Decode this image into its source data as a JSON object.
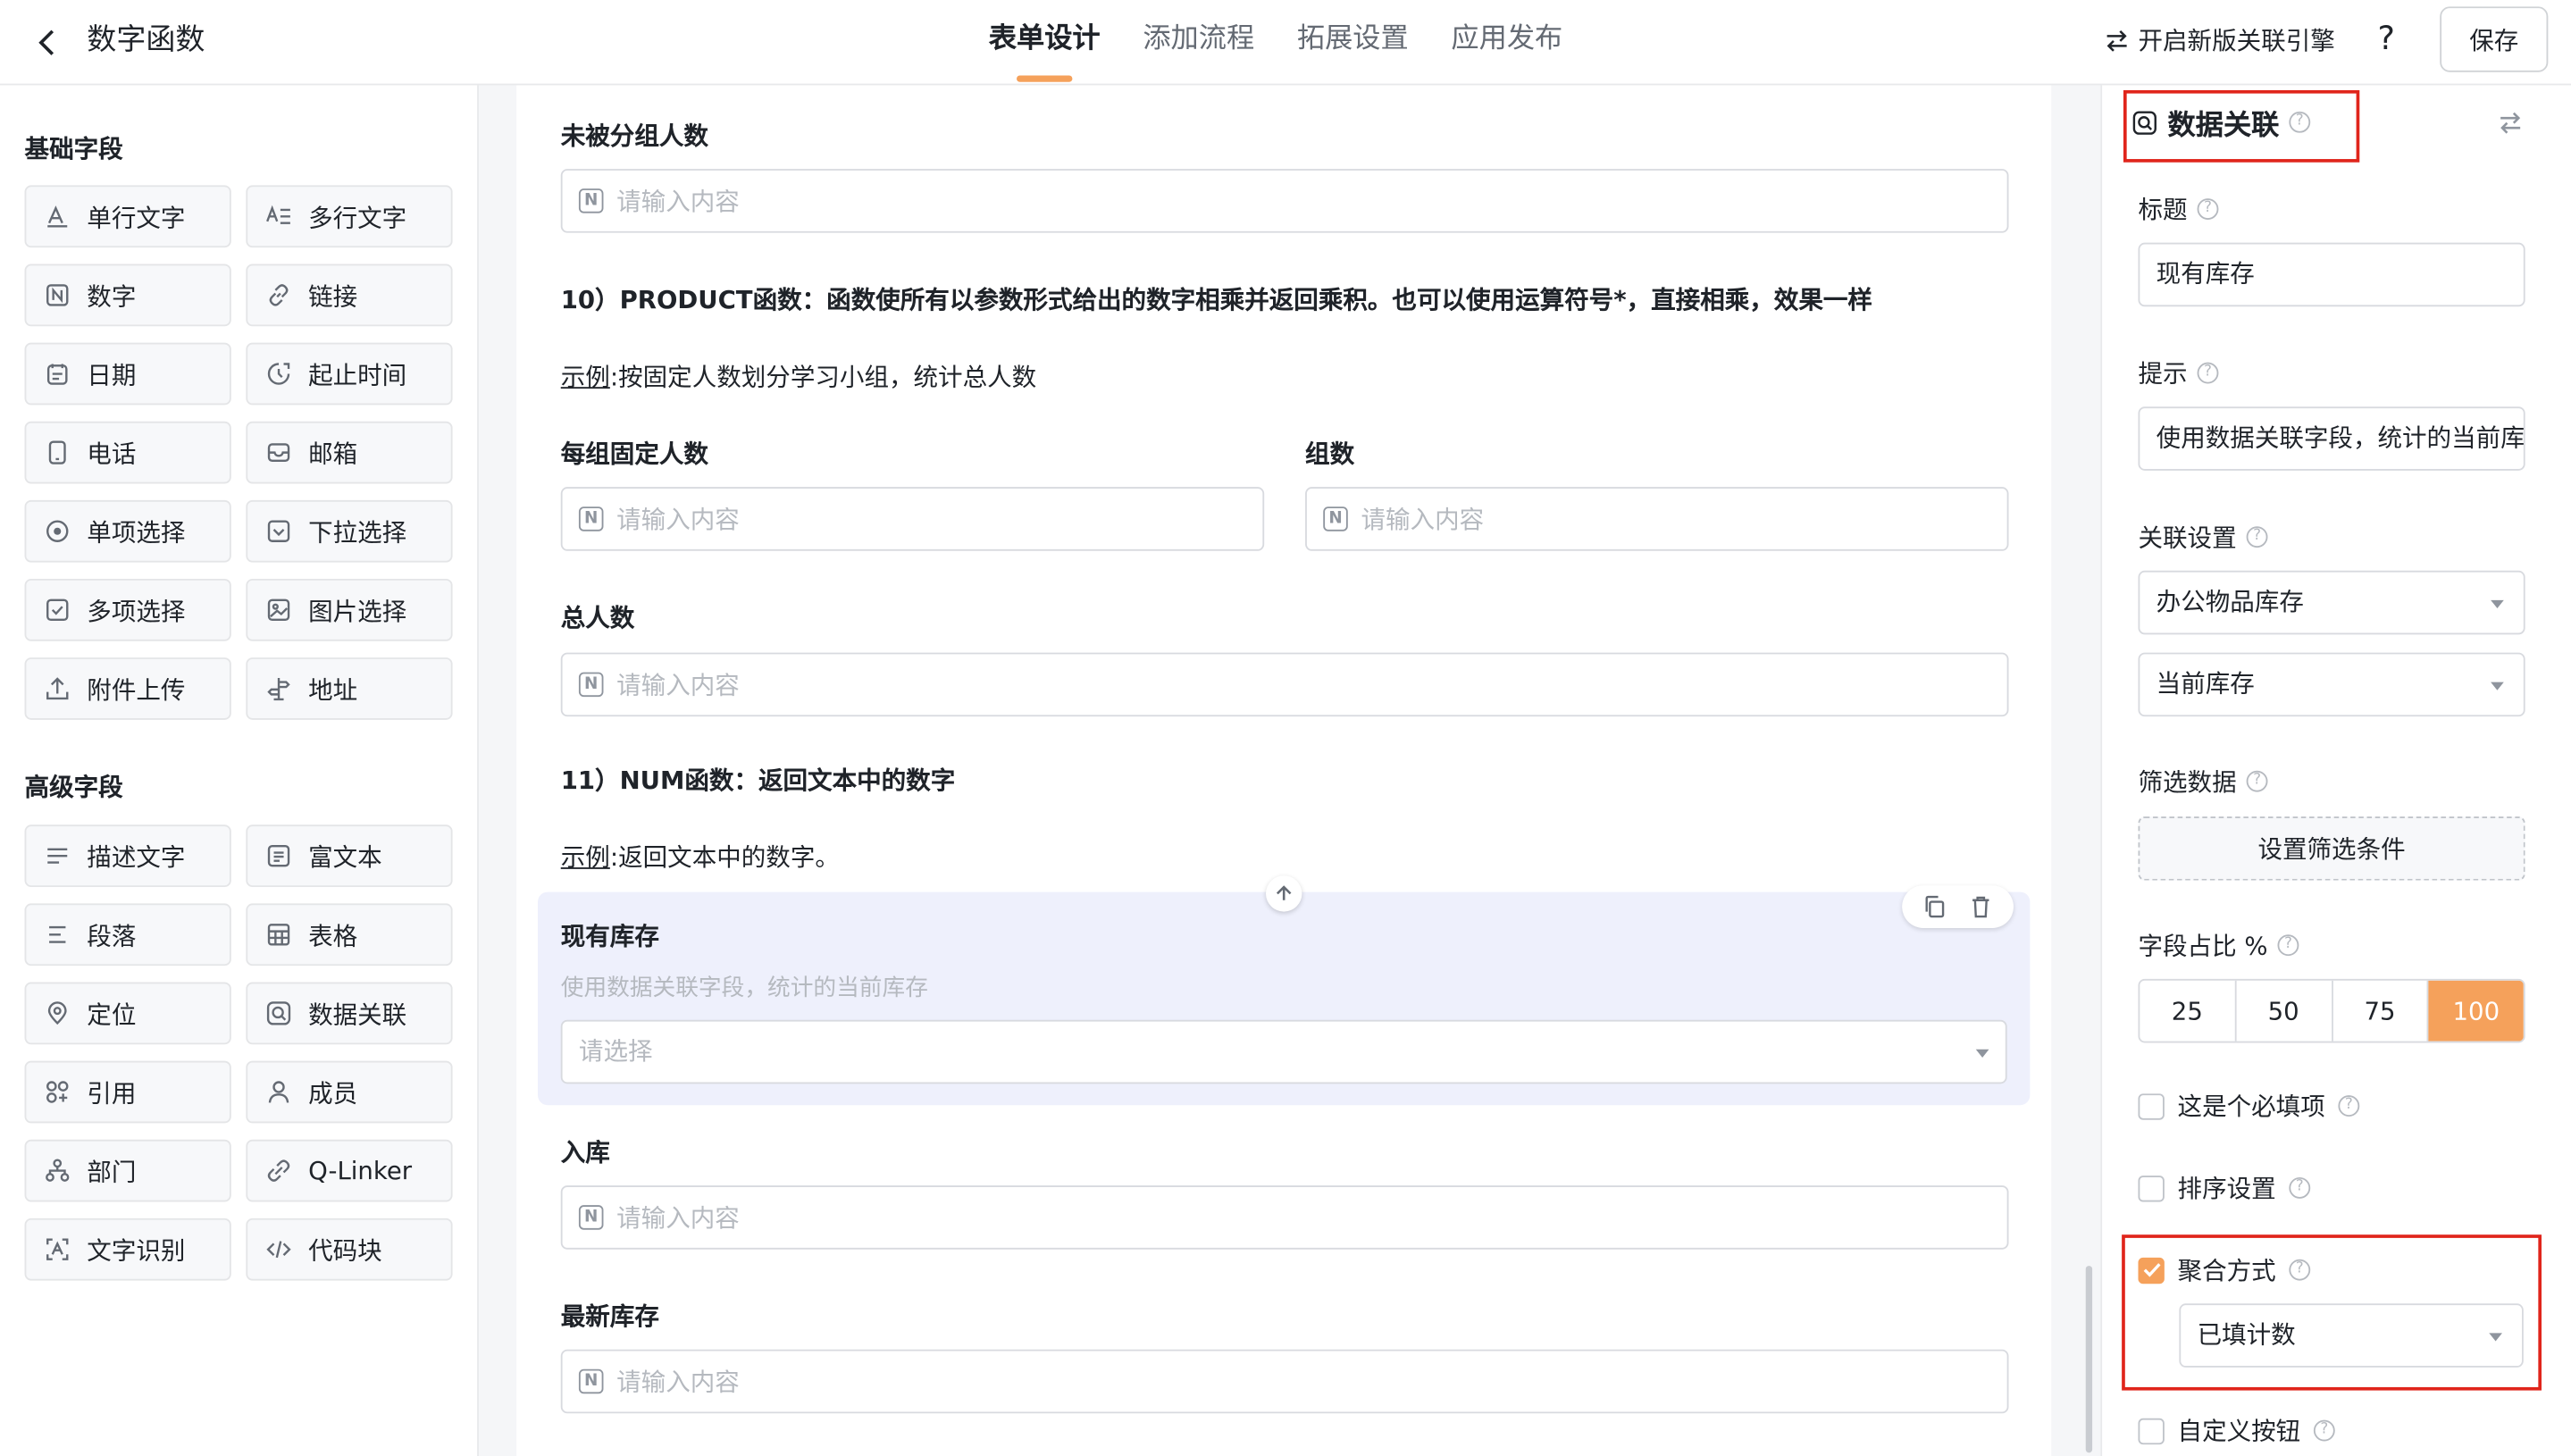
{
  "header": {
    "title": "数字函数",
    "tabs": [
      {
        "label": "表单设计",
        "active": true
      },
      {
        "label": "添加流程",
        "active": false
      },
      {
        "label": "拓展设置",
        "active": false
      },
      {
        "label": "应用发布",
        "active": false
      }
    ],
    "engine_label": "开启新版关联引擎",
    "help_label": "?",
    "save_label": "保存"
  },
  "left": {
    "basic_title": "基础字段",
    "basic_fields": [
      {
        "label": "单行文字",
        "icon": "single-line-text-icon"
      },
      {
        "label": "多行文字",
        "icon": "multi-line-text-icon"
      },
      {
        "label": "数字",
        "icon": "number-icon"
      },
      {
        "label": "链接",
        "icon": "link-icon"
      },
      {
        "label": "日期",
        "icon": "calendar-icon"
      },
      {
        "label": "起止时间",
        "icon": "time-range-icon"
      },
      {
        "label": "电话",
        "icon": "phone-icon"
      },
      {
        "label": "邮箱",
        "icon": "mail-icon"
      },
      {
        "label": "单项选择",
        "icon": "radio-icon"
      },
      {
        "label": "下拉选择",
        "icon": "dropdown-icon"
      },
      {
        "label": "多项选择",
        "icon": "checkbox-icon"
      },
      {
        "label": "图片选择",
        "icon": "image-icon"
      },
      {
        "label": "附件上传",
        "icon": "upload-icon"
      },
      {
        "label": "地址",
        "icon": "signpost-icon"
      }
    ],
    "advanced_title": "高级字段",
    "advanced_fields": [
      {
        "label": "描述文字",
        "icon": "description-icon"
      },
      {
        "label": "富文本",
        "icon": "rich-text-icon"
      },
      {
        "label": "段落",
        "icon": "paragraph-icon"
      },
      {
        "label": "表格",
        "icon": "table-icon"
      },
      {
        "label": "定位",
        "icon": "location-icon"
      },
      {
        "label": "数据关联",
        "icon": "data-link-icon"
      },
      {
        "label": "引用",
        "icon": "reference-icon"
      },
      {
        "label": "成员",
        "icon": "member-icon"
      },
      {
        "label": "部门",
        "icon": "department-icon"
      },
      {
        "label": "Q-Linker",
        "icon": "qlinker-icon"
      },
      {
        "label": "文字识别",
        "icon": "ocr-icon"
      },
      {
        "label": "代码块",
        "icon": "code-icon"
      }
    ]
  },
  "canvas": {
    "ungrouped_label": "未被分组人数",
    "placeholder": "请输入内容",
    "product_title": "10）PRODUCT函数：函数使所有以参数形式给出的数字相乘并返回乘积。也可以使用运算符号*，直接相乘，效果一样",
    "example_word": "示例",
    "product_example": ":按固定人数划分学习小组，统计总人数",
    "per_group_label": "每组固定人数",
    "groups_label": "组数",
    "total_label": "总人数",
    "num_title": "11）NUM函数：返回文本中的数字",
    "num_example": ":返回文本中的数字。",
    "selected_field": {
      "label": "现有库存",
      "hint": "使用数据关联字段，统计的当前库存",
      "select_placeholder": "请选择"
    },
    "inbound_label": "入库",
    "latest_label": "最新库存"
  },
  "right": {
    "panel_title": "数据关联",
    "title_label": "标题",
    "title_value": "现有库存",
    "hint_label": "提示",
    "hint_value": "使用数据关联字段，统计的当前库存",
    "link_label": "关联设置",
    "link_source": "办公物品库存",
    "link_field": "当前库存",
    "filter_label": "筛选数据",
    "filter_button": "设置筛选条件",
    "ratio_label": "字段占比 %",
    "ratio_options": [
      "25",
      "50",
      "75",
      "100"
    ],
    "ratio_selected": "100",
    "required_label": "这是个必填项",
    "sort_label": "排序设置",
    "aggregate_label": "聚合方式",
    "aggregate_value": "已填计数",
    "custom_button_label": "自定义按钮"
  },
  "colors": {
    "accent": "#f5a15b",
    "highlight_box": "#e0251b",
    "selected_block_bg": "#eef0fc"
  }
}
